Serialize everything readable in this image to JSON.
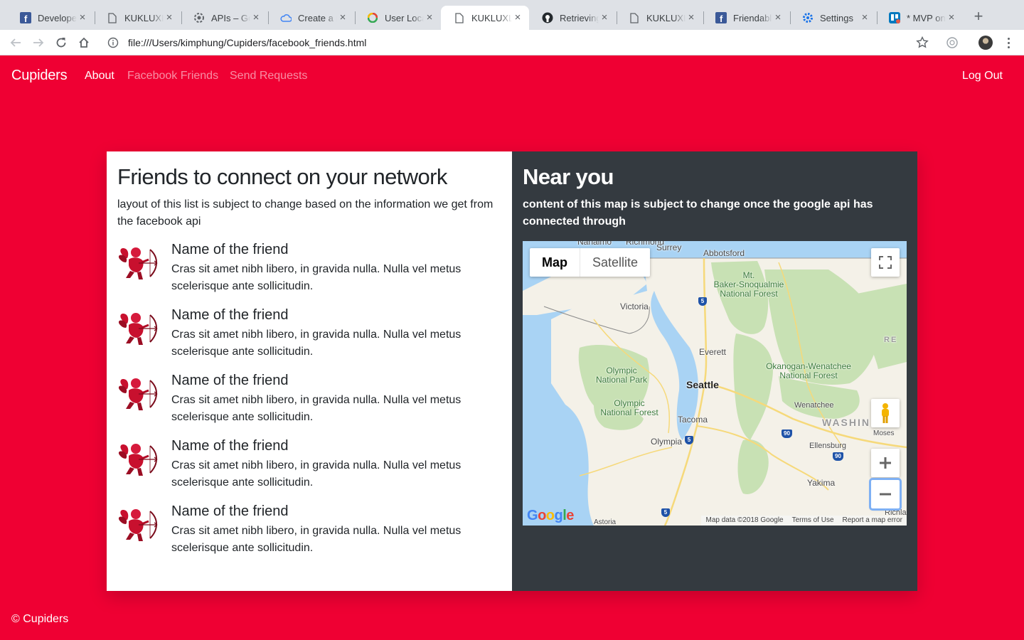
{
  "browser": {
    "tabs": [
      {
        "title": "Developers",
        "icon": "facebook-icon"
      },
      {
        "title": "KUKLUXLUX",
        "icon": "document-icon"
      },
      {
        "title": "APIs – Google",
        "icon": "gear-icon"
      },
      {
        "title": "Create a new",
        "icon": "cloud-icon"
      },
      {
        "title": "User Location",
        "icon": "google-icon"
      },
      {
        "title": "KUKLUXLUX",
        "icon": "document-icon",
        "active": true
      },
      {
        "title": "Retrieving",
        "icon": "github-icon"
      },
      {
        "title": "KUKLUXLUX",
        "icon": "document-icon"
      },
      {
        "title": "Friendable",
        "icon": "facebook-icon"
      },
      {
        "title": "Settings",
        "icon": "settings-icon"
      },
      {
        "title": "* MVP on",
        "icon": "trello-icon"
      }
    ],
    "close_glyph": "×",
    "new_tab_glyph": "+",
    "url": "file:///Users/kimphung/Cupiders/facebook_friends.html"
  },
  "navbar": {
    "brand": "Cupiders",
    "links": {
      "about": "About",
      "friends": "Facebook Friends",
      "send": "Send Requests"
    },
    "logout": "Log Out"
  },
  "friends_panel": {
    "heading": "Friends to connect on your network",
    "lead": "layout of this list is subject to change based on the information we get from the facebook api",
    "friends": [
      {
        "name": "Name of the friend",
        "desc": "Cras sit amet nibh libero, in gravida nulla. Nulla vel metus scelerisque ante sollicitudin."
      },
      {
        "name": "Name of the friend",
        "desc": "Cras sit amet nibh libero, in gravida nulla. Nulla vel metus scelerisque ante sollicitudin."
      },
      {
        "name": "Name of the friend",
        "desc": "Cras sit amet nibh libero, in gravida nulla. Nulla vel metus scelerisque ante sollicitudin."
      },
      {
        "name": "Name of the friend",
        "desc": "Cras sit amet nibh libero, in gravida nulla. Nulla vel metus scelerisque ante sollicitudin."
      },
      {
        "name": "Name of the friend",
        "desc": "Cras sit amet nibh libero, in gravida nulla. Nulla vel metus scelerisque ante sollicitudin."
      }
    ]
  },
  "map_panel": {
    "heading": "Near you",
    "lead": "content of this map is subject to change once the google api has connected through",
    "map_type": {
      "map": "Map",
      "satellite": "Satellite"
    },
    "places": {
      "nanaimo": "Nanaimo",
      "richmond": "Richmond",
      "surrey": "Surrey",
      "abbotsford": "Abbotsford",
      "baker1": "Mt.",
      "baker2": "Baker-Snoqualmie",
      "baker3": "National Forest",
      "victoria": "Victoria",
      "everett": "Everett",
      "olypark1": "Olympic",
      "olypark2": "National Park",
      "seattle": "Seattle",
      "okan1": "Okanogan-Wenatchee",
      "okan2": "National Forest",
      "olyforest1": "Olympic",
      "olyforest2": "National Forest",
      "wenatchee": "Wenatchee",
      "tacoma": "Tacoma",
      "washington": "WASHIN",
      "moses": "Moses",
      "olympia": "Olympia",
      "ellensburg": "Ellensburg",
      "yakima": "Yakima",
      "astoria": "Astoria",
      "richland": "Richla",
      "re": "RE"
    },
    "shields": {
      "i5": "5",
      "i90": "90"
    },
    "google_logo": {
      "g1": "G",
      "o1": "o",
      "o2": "o",
      "g2": "g",
      "l": "l",
      "e": "e"
    },
    "google_colors": {
      "blue": "#4285f4",
      "red": "#ea4335",
      "yellow": "#fbbc05",
      "green": "#34a853"
    },
    "attribution": {
      "data": "Map data ©2018 Google",
      "terms": "Terms of Use",
      "report": "Report a map error"
    }
  },
  "footer": "© Cupiders",
  "colors": {
    "brand": "#ef0033",
    "panel_dark": "#343a40",
    "water": "#a9d3f4",
    "land": "#f4f1e8",
    "forest": "#c8e1b4"
  }
}
